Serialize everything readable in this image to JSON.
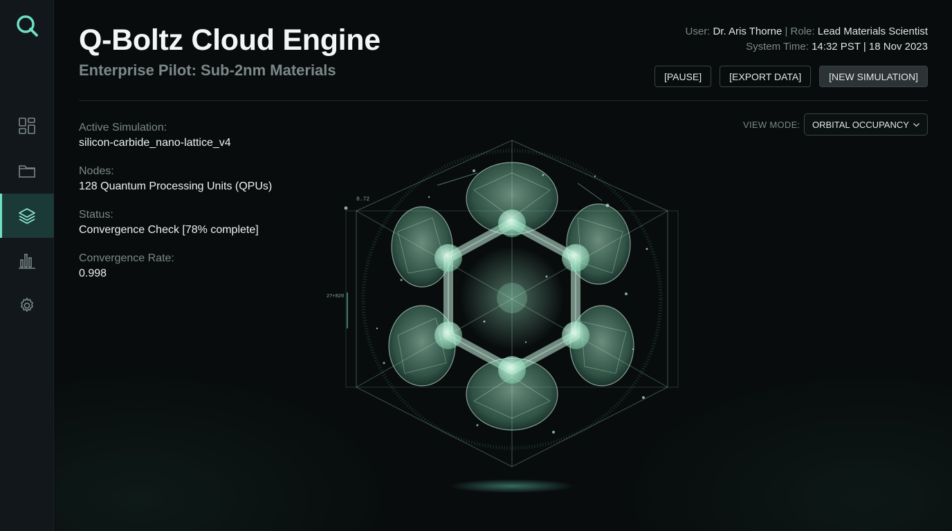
{
  "app": {
    "title": "Q-Boltz Cloud Engine",
    "subtitle": "Enterprise Pilot: Sub-2nm Materials"
  },
  "user": {
    "user_label": "User:",
    "user_name": "Dr. Aris Thorne",
    "separator": "|",
    "role_label": "Role:",
    "role_value": "Lead Materials Scientist",
    "time_label": "System Time:",
    "time_value": "14:32 PST | 18 Nov 2023"
  },
  "toolbar": {
    "pause_label": "[PAUSE]",
    "export_label": "[EXPORT DATA]",
    "new_sim_label": "[NEW SIMULATION]"
  },
  "sidebar": {
    "items": [
      {
        "icon": "dashboard-icon",
        "active": false
      },
      {
        "icon": "folder-icon",
        "active": false
      },
      {
        "icon": "layers-icon",
        "active": true
      },
      {
        "icon": "bar-chart-icon",
        "active": false
      },
      {
        "icon": "gear-icon",
        "active": false
      }
    ]
  },
  "simulation": {
    "active_label": "Active Simulation:",
    "active_value": "silicon-carbide_nano-lattice_v4",
    "nodes_label": "Nodes:",
    "nodes_value": "128 Quantum Processing Units (QPUs)",
    "status_label": "Status:",
    "status_value": "Convergence Check [78% complete]",
    "rate_label": "Convergence Rate:",
    "rate_value": "0.998"
  },
  "view_mode": {
    "label": "VIEW MODE:",
    "selected": "ORBITAL OCCUPANCY"
  },
  "viz_annotations": {
    "top_left": "8.72",
    "left": "27+820"
  },
  "colors": {
    "accent": "#6fe0c4",
    "background": "#080c0d",
    "sidebar": "#11171a",
    "orbital": "#9fe8c6"
  }
}
